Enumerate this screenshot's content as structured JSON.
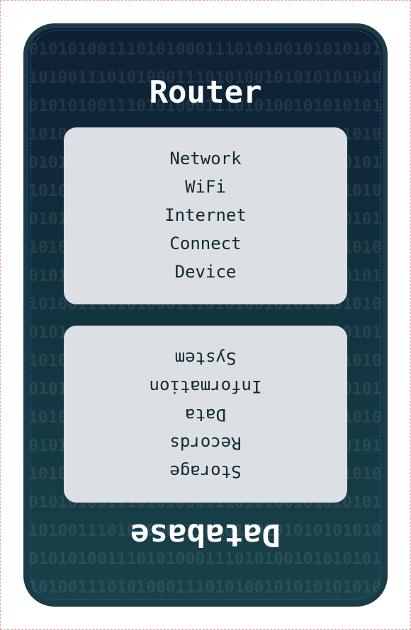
{
  "binary_pattern": "0101010011101010001110101001010101010100111010100011101010010101",
  "router": {
    "title": "Router",
    "items": [
      "Network",
      "WiFi",
      "Internet",
      "Connect",
      "Device"
    ]
  },
  "database": {
    "title": "Database",
    "items": [
      "Storage",
      "Records",
      "Data",
      "Information",
      "System"
    ]
  },
  "colors": {
    "card_border": "#1b3c44",
    "gradient_top": "#0d2033",
    "gradient_bottom": "#194149",
    "panel": "#dcdfe3",
    "panel_text": "#0f2a30",
    "title_text": "#ffffff"
  }
}
